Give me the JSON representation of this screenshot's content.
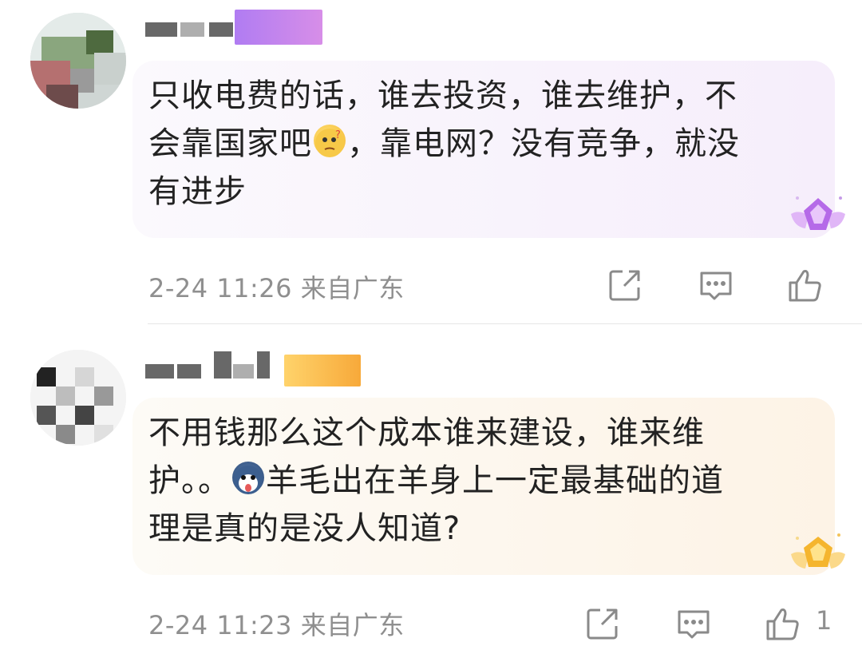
{
  "comments": [
    {
      "text": "只收电费的话，谁去投资，谁去维护，不\n会靠国家吧",
      "text_after_emoji": "，靠电网？没有竞争，就没\n有进步",
      "inline_emoji": "thinking-face",
      "time": "2-24 11:26",
      "location": "来自广东",
      "medal": "purple-diamond-medal",
      "bubble_color": "#f6eefb",
      "like_count": ""
    },
    {
      "text": "不用钱那么这个成本谁来建设，谁来维\n护。。",
      "text_after_emoji": "羊毛出在羊身上一定最基础的道\n理是真的是没人知道?",
      "inline_emoji": "husky-face",
      "time": "2-24 11:23",
      "location": "来自广东",
      "medal": "gold-medal",
      "bubble_color": "#fdf3e6",
      "like_count": "1"
    }
  ],
  "icons": {
    "share": "share-icon",
    "reply": "reply-icon",
    "like": "thumbs-up-icon"
  },
  "colors": {
    "meta_text": "#8f8f8f",
    "icon_stroke": "#8a8a8a"
  }
}
